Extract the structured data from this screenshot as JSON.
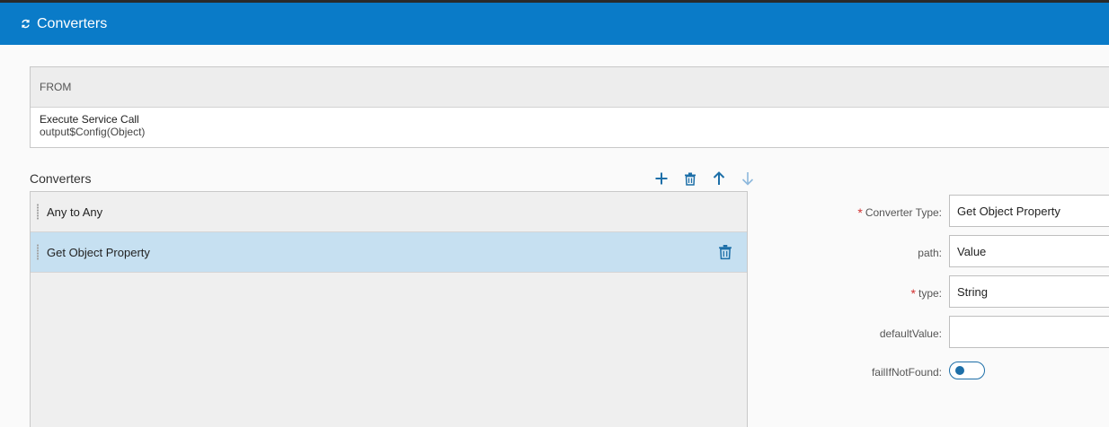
{
  "header": {
    "title": "Converters",
    "icon": "refresh-icon"
  },
  "from": {
    "heading": "FROM",
    "source_name": "Execute Service Call",
    "source_detail": "output$Config(Object)"
  },
  "converters": {
    "section_label": "Converters",
    "toolbar": {
      "add_icon": "plus-icon",
      "delete_icon": "trash-icon",
      "up_icon": "arrow-up-icon",
      "down_icon": "arrow-down-icon"
    },
    "items": [
      {
        "label": "Any to Any",
        "selected": false
      },
      {
        "label": "Get Object Property",
        "selected": true
      }
    ]
  },
  "form": {
    "converter_type": {
      "label": "Converter Type:",
      "value": "Get Object Property",
      "required": true
    },
    "path": {
      "label": "path:",
      "value": "Value",
      "required": false
    },
    "type": {
      "label": "type:",
      "value": "String",
      "required": true
    },
    "default_value": {
      "label": "defaultValue:",
      "value": "",
      "required": false
    },
    "fail_if_not_found": {
      "label": "failIfNotFound:",
      "value": false
    }
  },
  "colors": {
    "header_bg": "#0a7bc8",
    "accent": "#1d6fa8",
    "selected_row": "#c6e0f1",
    "required": "#d23030"
  }
}
